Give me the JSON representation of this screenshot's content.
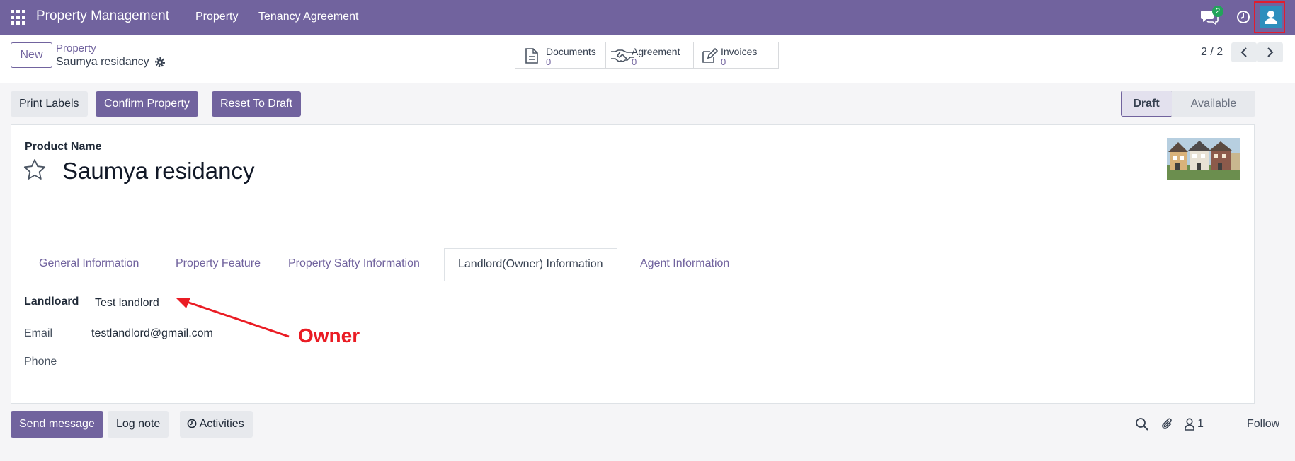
{
  "navbar": {
    "brand": "Property Management",
    "menus": [
      "Property",
      "Tenancy Agreement"
    ],
    "chat_badge": "2",
    "colors": {
      "navbar": "#71639e",
      "badge": "#22a35a",
      "avatar": "#2d8fbd",
      "highlight_box": "#e11d2e"
    }
  },
  "control": {
    "new_label": "New",
    "breadcrumb_parent": "Property",
    "breadcrumb_current": "Saumya residancy",
    "smart_buttons": [
      {
        "label": "Documents",
        "value": "0",
        "icon": "file-icon"
      },
      {
        "label": "Agreement",
        "value": "0",
        "icon": "handshake-icon"
      },
      {
        "label": "Invoices",
        "value": "0",
        "icon": "edit-icon"
      }
    ],
    "pager": "2 / 2"
  },
  "actions": {
    "print_labels": "Print Labels",
    "confirm_property": "Confirm Property",
    "reset_to_draft": "Reset To Draft"
  },
  "status": {
    "stages": [
      "Draft",
      "Available"
    ],
    "current": "Draft"
  },
  "form": {
    "product_name_label": "Product Name",
    "product_name_value": "Saumya residancy",
    "tabs": [
      "General Information",
      "Property Feature",
      "Property Safty Information",
      "Landlord(Owner) Information",
      "Agent Information"
    ],
    "active_tab": "Landlord(Owner) Information",
    "fields": {
      "landlord_label": "Landloard",
      "landlord_value": "Test landlord",
      "email_label": "Email",
      "email_value": "testlandlord@gmail.com",
      "phone_label": "Phone",
      "phone_value": ""
    }
  },
  "annotation": {
    "text": "Owner",
    "color": "#ea1c24"
  },
  "chatter": {
    "send_message": "Send message",
    "log_note": "Log note",
    "activities": "Activities",
    "followers_count": "1",
    "follow": "Follow"
  }
}
